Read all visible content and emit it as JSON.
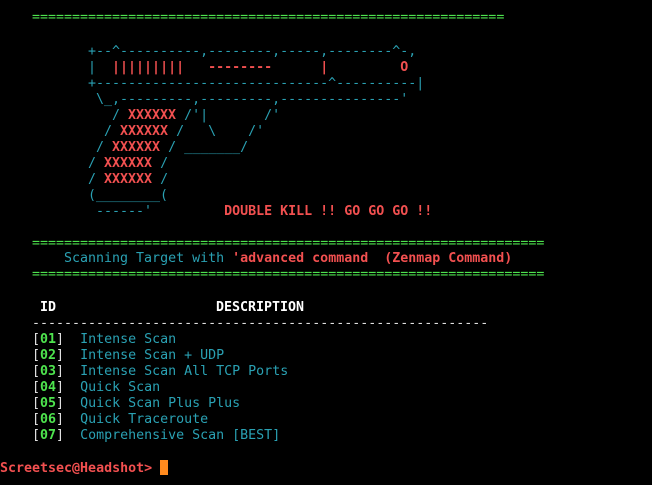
{
  "banner": {
    "separator_top": "===========================================================",
    "art": [
      {
        "parts": [
          {
            "cls": "c",
            "t": "+--^----------,--------,-----,--------^-,"
          }
        ]
      },
      {
        "parts": [
          {
            "cls": "c",
            "t": "|  "
          },
          {
            "cls": "r",
            "t": "|||||||||"
          },
          {
            "cls": "c",
            "t": "   "
          },
          {
            "cls": "r",
            "t": "--------"
          },
          {
            "cls": "c",
            "t": "      "
          },
          {
            "cls": "r",
            "t": "|"
          },
          {
            "cls": "c",
            "t": "         "
          },
          {
            "cls": "r",
            "t": "O"
          }
        ]
      },
      {
        "parts": [
          {
            "cls": "c",
            "t": "+-----------------------------^----------|"
          }
        ]
      },
      {
        "parts": [
          {
            "cls": "c",
            "t": " \\_,---------,---------,---------------'"
          }
        ]
      },
      {
        "parts": [
          {
            "cls": "c",
            "t": "   / "
          },
          {
            "cls": "r",
            "t": "XXXXXX"
          },
          {
            "cls": "c",
            "t": " /'|       /'"
          }
        ]
      },
      {
        "parts": [
          {
            "cls": "c",
            "t": "  / "
          },
          {
            "cls": "r",
            "t": "XXXXXX"
          },
          {
            "cls": "c",
            "t": " /   \\    /'"
          }
        ]
      },
      {
        "parts": [
          {
            "cls": "c",
            "t": " / "
          },
          {
            "cls": "r",
            "t": "XXXXXX"
          },
          {
            "cls": "c",
            "t": " / _______/"
          }
        ]
      },
      {
        "parts": [
          {
            "cls": "c",
            "t": "/ "
          },
          {
            "cls": "r",
            "t": "XXXXXX"
          },
          {
            "cls": "c",
            "t": " /"
          }
        ]
      },
      {
        "parts": [
          {
            "cls": "c",
            "t": "/ "
          },
          {
            "cls": "r",
            "t": "XXXXXX"
          },
          {
            "cls": "c",
            "t": " /"
          }
        ]
      },
      {
        "parts": [
          {
            "cls": "c",
            "t": "(________("
          }
        ]
      },
      {
        "parts": [
          {
            "cls": "c",
            "t": " ------'"
          },
          {
            "cls": "c",
            "t": "         "
          },
          {
            "cls": "r",
            "t": "DOUBLE KILL !! GO GO GO !!"
          }
        ]
      }
    ]
  },
  "header": {
    "separator": "================================================================",
    "scan_label": "Scanning Target with ",
    "scan_mode": "'advanced command  (Zenmap Command)"
  },
  "table": {
    "col_id": "ID",
    "col_description": "DESCRIPTION",
    "rule": "---------------------------------------------------------",
    "rows": [
      {
        "id": "01",
        "description": "Intense Scan"
      },
      {
        "id": "02",
        "description": "Intense Scan + UDP"
      },
      {
        "id": "03",
        "description": "Intense Scan All TCP Ports"
      },
      {
        "id": "04",
        "description": "Quick Scan"
      },
      {
        "id": "05",
        "description": "Quick Scan Plus Plus"
      },
      {
        "id": "06",
        "description": "Quick Traceroute"
      },
      {
        "id": "07",
        "description": "Comprehensive Scan [BEST]"
      }
    ]
  },
  "prompt": {
    "text": "Screetsec@Headshot> "
  },
  "colors": {
    "green": "#4ee44e",
    "cyan": "#2aa1b3",
    "red": "#f25050",
    "cursor": "#ff8a1e"
  }
}
